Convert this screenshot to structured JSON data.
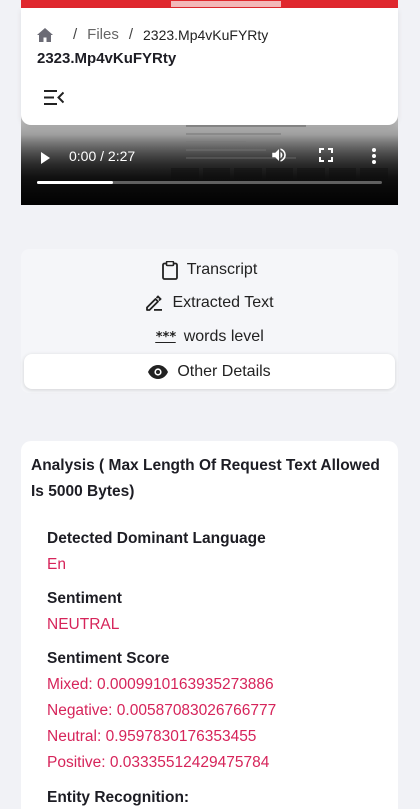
{
  "video": {
    "current_time": "0:00",
    "duration": "2:27",
    "time_separator": " / ",
    "progress": 0.22
  },
  "header": {
    "breadcrumb": {
      "home_icon": "home-icon",
      "separator": "/",
      "files_label": "Files",
      "current": "2323.Mp4vKuFYRty"
    },
    "title": "2323.Mp4vKuFYRty",
    "menu_icon": "menu-collapse-icon"
  },
  "tabs": {
    "transcript": "Transcript",
    "extracted_text": "Extracted Text",
    "words_level_prefix": "***",
    "words_level": "words level",
    "other_details": "Other Details"
  },
  "analysis": {
    "heading": "Analysis ( Max Length Of Request Text Allowed Is 5000 Bytes)",
    "detected_language_label": "Detected Dominant Language",
    "detected_language_value": "En",
    "sentiment_label": "Sentiment",
    "sentiment_value": "NEUTRAL",
    "sentiment_score_label": "Sentiment Score",
    "scores": {
      "mixed": "Mixed: 0.0009910163935273886",
      "negative": "Negative: 0.00587083026766777",
      "neutral": "Neutral: 0.9597830176353455",
      "positive": "Positive: 0.03335512429475784"
    },
    "entity_recognition_label": "Entity Recognition:"
  },
  "colors": {
    "accent": "#d6245a",
    "background": "#f1f2f6",
    "card": "#ffffff",
    "video_top_strip": "#e0282e"
  }
}
